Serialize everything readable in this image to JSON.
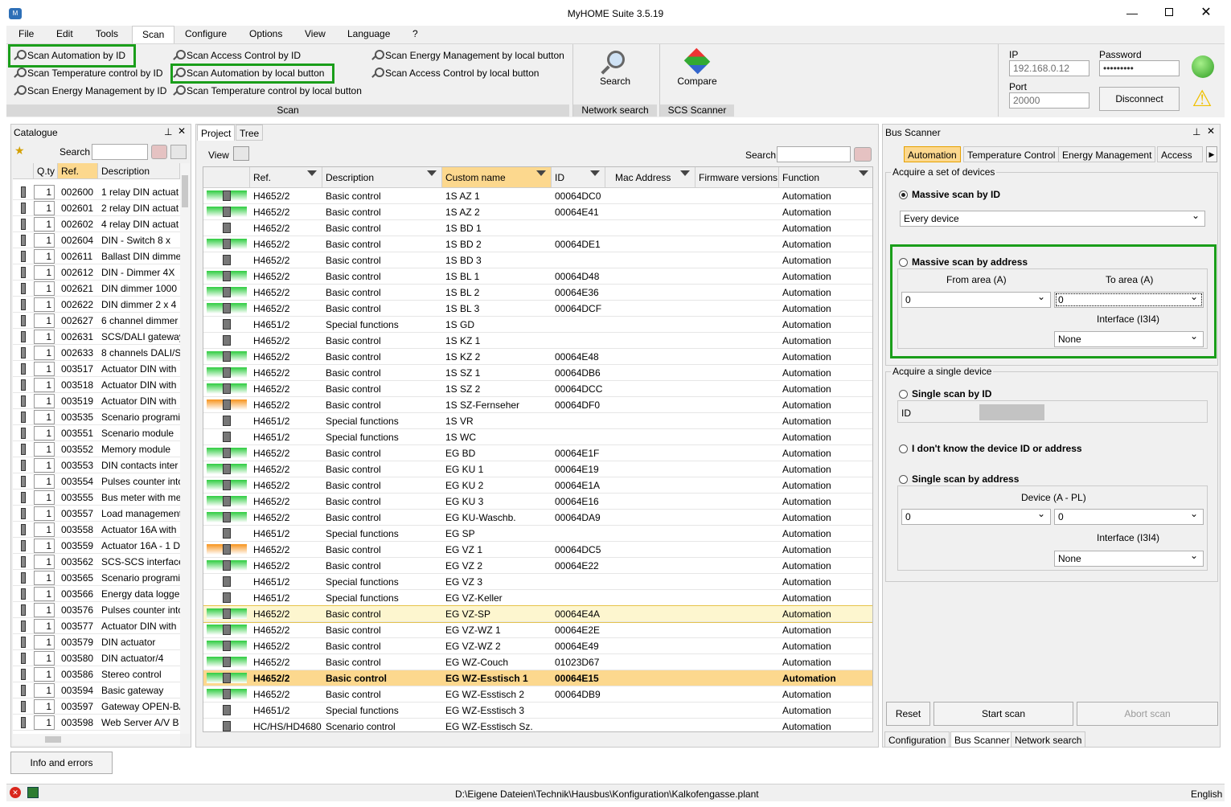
{
  "window": {
    "title": "MyHOME Suite 3.5.19"
  },
  "menu": [
    "File",
    "Edit",
    "Tools",
    "Scan",
    "Configure",
    "Options",
    "View",
    "Language",
    "?"
  ],
  "ribbon": {
    "scan_items": [
      "Scan Automation by ID",
      "Scan Temperature control by ID",
      "Scan Energy Management by ID",
      "Scan Access Control by ID",
      "Scan Automation by local button",
      "Scan Temperature control by local button",
      "Scan Energy Management by local button",
      "Scan Access Control by local button"
    ],
    "scan_group": "Scan",
    "search_label": "Search",
    "network_search_group": "Network search",
    "compare_label": "Compare",
    "scs_group": "SCS Scanner",
    "connection": {
      "ip_label": "IP",
      "ip_value": "192.168.0.12",
      "password_label": "Password",
      "password_value": "•••••••••",
      "port_label": "Port",
      "port_value": "20000",
      "disconnect": "Disconnect"
    }
  },
  "catalogue": {
    "title": "Catalogue",
    "search_label": "Search",
    "columns": [
      "Q.ty",
      "Ref.",
      "Description"
    ],
    "rows": [
      [
        "1",
        "002600",
        "1 relay DIN actuat"
      ],
      [
        "1",
        "002601",
        "2 relay DIN actuat"
      ],
      [
        "1",
        "002602",
        "4 relay DIN actuat"
      ],
      [
        "1",
        "002604",
        "DIN - Switch  8 x"
      ],
      [
        "1",
        "002611",
        "Ballast DIN dimme"
      ],
      [
        "1",
        "002612",
        "DIN - Dimmer 4X"
      ],
      [
        "1",
        "002621",
        "DIN dimmer 1000"
      ],
      [
        "1",
        "002622",
        "DIN dimmer 2 x 4"
      ],
      [
        "1",
        "002627",
        "6 channel dimmer"
      ],
      [
        "1",
        "002631",
        "SCS/DALI gateway"
      ],
      [
        "1",
        "002633",
        "8 channels DALI/S"
      ],
      [
        "1",
        "003517",
        "Actuator DIN with"
      ],
      [
        "1",
        "003518",
        "Actuator DIN with"
      ],
      [
        "1",
        "003519",
        "Actuator DIN with"
      ],
      [
        "1",
        "003535",
        "Scenario programi"
      ],
      [
        "1",
        "003551",
        "Scenario module"
      ],
      [
        "1",
        "003552",
        "Memory module"
      ],
      [
        "1",
        "003553",
        "DIN contacts inter"
      ],
      [
        "1",
        "003554",
        "Pulses counter into"
      ],
      [
        "1",
        "003555",
        "Bus meter with me"
      ],
      [
        "1",
        "003557",
        "Load management"
      ],
      [
        "1",
        "003558",
        "Actuator 16A with"
      ],
      [
        "1",
        "003559",
        "Actuator 16A - 1 D"
      ],
      [
        "1",
        "003562",
        "SCS-SCS interface"
      ],
      [
        "1",
        "003565",
        "Scenario programi"
      ],
      [
        "1",
        "003566",
        "Energy data logge"
      ],
      [
        "1",
        "003576",
        "Pulses counter into"
      ],
      [
        "1",
        "003577",
        "Actuator DIN with"
      ],
      [
        "1",
        "003579",
        "DIN actuator"
      ],
      [
        "1",
        "003580",
        "DIN actuator/4"
      ],
      [
        "1",
        "003586",
        "Stereo control"
      ],
      [
        "1",
        "003594",
        "Basic gateway"
      ],
      [
        "1",
        "003597",
        "Gateway OPEN-BA"
      ],
      [
        "1",
        "003598",
        "Web Server A/V B"
      ]
    ],
    "info_button": "Info and errors"
  },
  "project": {
    "tabs": [
      "Project",
      "Tree"
    ],
    "view_label": "View",
    "search_label": "Search",
    "columns": [
      "Ref.",
      "Description",
      "Custom name",
      "ID",
      "Mac Address",
      "Firmware versions",
      "Function"
    ],
    "rows": [
      {
        "s": "g",
        "ref": "H4652/2",
        "desc": "Basic control",
        "name": "1S AZ 1",
        "id": "00064DC0",
        "fn": "Automation"
      },
      {
        "s": "g",
        "ref": "H4652/2",
        "desc": "Basic control",
        "name": "1S AZ 2",
        "id": "00064E41",
        "fn": "Automation"
      },
      {
        "s": "n",
        "ref": "H4652/2",
        "desc": "Basic control",
        "name": "1S BD 1",
        "id": "",
        "fn": "Automation"
      },
      {
        "s": "g",
        "ref": "H4652/2",
        "desc": "Basic control",
        "name": "1S BD 2",
        "id": "00064DE1",
        "fn": "Automation"
      },
      {
        "s": "n",
        "ref": "H4652/2",
        "desc": "Basic control",
        "name": "1S BD 3",
        "id": "",
        "fn": "Automation"
      },
      {
        "s": "g",
        "ref": "H4652/2",
        "desc": "Basic control",
        "name": "1S BL 1",
        "id": "00064D48",
        "fn": "Automation"
      },
      {
        "s": "g",
        "ref": "H4652/2",
        "desc": "Basic control",
        "name": "1S BL 2",
        "id": "00064E36",
        "fn": "Automation"
      },
      {
        "s": "g",
        "ref": "H4652/2",
        "desc": "Basic control",
        "name": "1S BL 3",
        "id": "00064DCF",
        "fn": "Automation"
      },
      {
        "s": "n",
        "ref": "H4651/2",
        "desc": "Special functions",
        "name": "1S GD",
        "id": "",
        "fn": "Automation"
      },
      {
        "s": "n",
        "ref": "H4652/2",
        "desc": "Basic control",
        "name": "1S KZ 1",
        "id": "",
        "fn": "Automation"
      },
      {
        "s": "g",
        "ref": "H4652/2",
        "desc": "Basic control",
        "name": "1S KZ 2",
        "id": "00064E48",
        "fn": "Automation"
      },
      {
        "s": "g",
        "ref": "H4652/2",
        "desc": "Basic control",
        "name": "1S SZ 1",
        "id": "00064DB6",
        "fn": "Automation"
      },
      {
        "s": "g",
        "ref": "H4652/2",
        "desc": "Basic control",
        "name": "1S SZ 2",
        "id": "00064DCC",
        "fn": "Automation"
      },
      {
        "s": "o",
        "ref": "H4652/2",
        "desc": "Basic control",
        "name": "1S SZ-Fernseher",
        "id": "00064DF0",
        "fn": "Automation"
      },
      {
        "s": "n",
        "ref": "H4651/2",
        "desc": "Special functions",
        "name": "1S VR",
        "id": "",
        "fn": "Automation"
      },
      {
        "s": "n",
        "ref": "H4651/2",
        "desc": "Special functions",
        "name": "1S WC",
        "id": "",
        "fn": "Automation"
      },
      {
        "s": "g",
        "ref": "H4652/2",
        "desc": "Basic control",
        "name": "EG BD",
        "id": "00064E1F",
        "fn": "Automation"
      },
      {
        "s": "g",
        "ref": "H4652/2",
        "desc": "Basic control",
        "name": "EG KU 1",
        "id": "00064E19",
        "fn": "Automation"
      },
      {
        "s": "g",
        "ref": "H4652/2",
        "desc": "Basic control",
        "name": "EG KU 2",
        "id": "00064E1A",
        "fn": "Automation"
      },
      {
        "s": "g",
        "ref": "H4652/2",
        "desc": "Basic control",
        "name": "EG KU 3",
        "id": "00064E16",
        "fn": "Automation"
      },
      {
        "s": "g",
        "ref": "H4652/2",
        "desc": "Basic control",
        "name": "EG KU-Waschb.",
        "id": "00064DA9",
        "fn": "Automation"
      },
      {
        "s": "n",
        "ref": "H4651/2",
        "desc": "Special functions",
        "name": "EG SP",
        "id": "",
        "fn": "Automation"
      },
      {
        "s": "o",
        "ref": "H4652/2",
        "desc": "Basic control",
        "name": "EG VZ 1",
        "id": "00064DC5",
        "fn": "Automation"
      },
      {
        "s": "g",
        "ref": "H4652/2",
        "desc": "Basic control",
        "name": "EG VZ 2",
        "id": "00064E22",
        "fn": "Automation"
      },
      {
        "s": "n",
        "ref": "H4651/2",
        "desc": "Special functions",
        "name": "EG VZ 3",
        "id": "",
        "fn": "Automation"
      },
      {
        "s": "n",
        "ref": "H4651/2",
        "desc": "Special functions",
        "name": "EG VZ-Keller",
        "id": "",
        "fn": "Automation"
      },
      {
        "s": "g",
        "ref": "H4652/2",
        "desc": "Basic control",
        "name": "EG VZ-SP",
        "id": "00064E4A",
        "fn": "Automation",
        "hl": "hover"
      },
      {
        "s": "g",
        "ref": "H4652/2",
        "desc": "Basic control",
        "name": "EG VZ-WZ 1",
        "id": "00064E2E",
        "fn": "Automation"
      },
      {
        "s": "g",
        "ref": "H4652/2",
        "desc": "Basic control",
        "name": "EG VZ-WZ 2",
        "id": "00064E49",
        "fn": "Automation"
      },
      {
        "s": "g",
        "ref": "H4652/2",
        "desc": "Basic control",
        "name": "EG WZ-Couch",
        "id": "01023D67",
        "fn": "Automation"
      },
      {
        "s": "g",
        "ref": "H4652/2",
        "desc": "Basic control",
        "name": "EG WZ-Esstisch 1",
        "id": "00064E15",
        "fn": "Automation",
        "hl": "sel"
      },
      {
        "s": "g",
        "ref": "H4652/2",
        "desc": "Basic control",
        "name": "EG WZ-Esstisch 2",
        "id": "00064DB9",
        "fn": "Automation"
      },
      {
        "s": "n",
        "ref": "H4651/2",
        "desc": "Special functions",
        "name": "EG WZ-Esstisch 3",
        "id": "",
        "fn": "Automation"
      },
      {
        "s": "n",
        "ref": "HC/HS/HD4680",
        "desc": "Scenario control",
        "name": "EG WZ-Esstisch Sz.",
        "id": "",
        "fn": "Automation"
      }
    ]
  },
  "bus_scanner": {
    "title": "Bus Scanner",
    "tabs": [
      "Automation",
      "Temperature Control",
      "Energy Management",
      "Access cc"
    ],
    "acquire_set": "Acquire a set of devices",
    "massive_id": "Massive scan by ID",
    "every_device": "Every device",
    "massive_address": "Massive scan by address",
    "from_area": "From area (A)",
    "to_area": "To area (A)",
    "from_val": "0",
    "to_val": "0",
    "interface": "Interface (I3I4)",
    "interface_val": "None",
    "acquire_single": "Acquire a single device",
    "single_id": "Single scan by ID",
    "id_label": "ID",
    "dont_know": "I don't know the device ID or address",
    "single_address": "Single scan by address",
    "device_label": "Device (A - PL)",
    "dev_a": "0",
    "dev_pl": "0",
    "interface2": "Interface (I3I4)",
    "interface2_val": "None",
    "reset": "Reset",
    "start": "Start scan",
    "abort": "Abort scan",
    "bottom_tabs": [
      "Configuration",
      "Bus Scanner",
      "Network search"
    ]
  },
  "status": {
    "path": "D:\\Eigene Dateien\\Technik\\Hausbus\\Konfiguration\\Kalkofengasse.plant",
    "lang": "English"
  },
  "colors": {
    "green_highlight": "#1a9e1a",
    "selected_row": "#fcd88e",
    "hover_row": "#fdf6cf",
    "status_green": "#2ecc40",
    "status_orange": "#f7941d"
  }
}
